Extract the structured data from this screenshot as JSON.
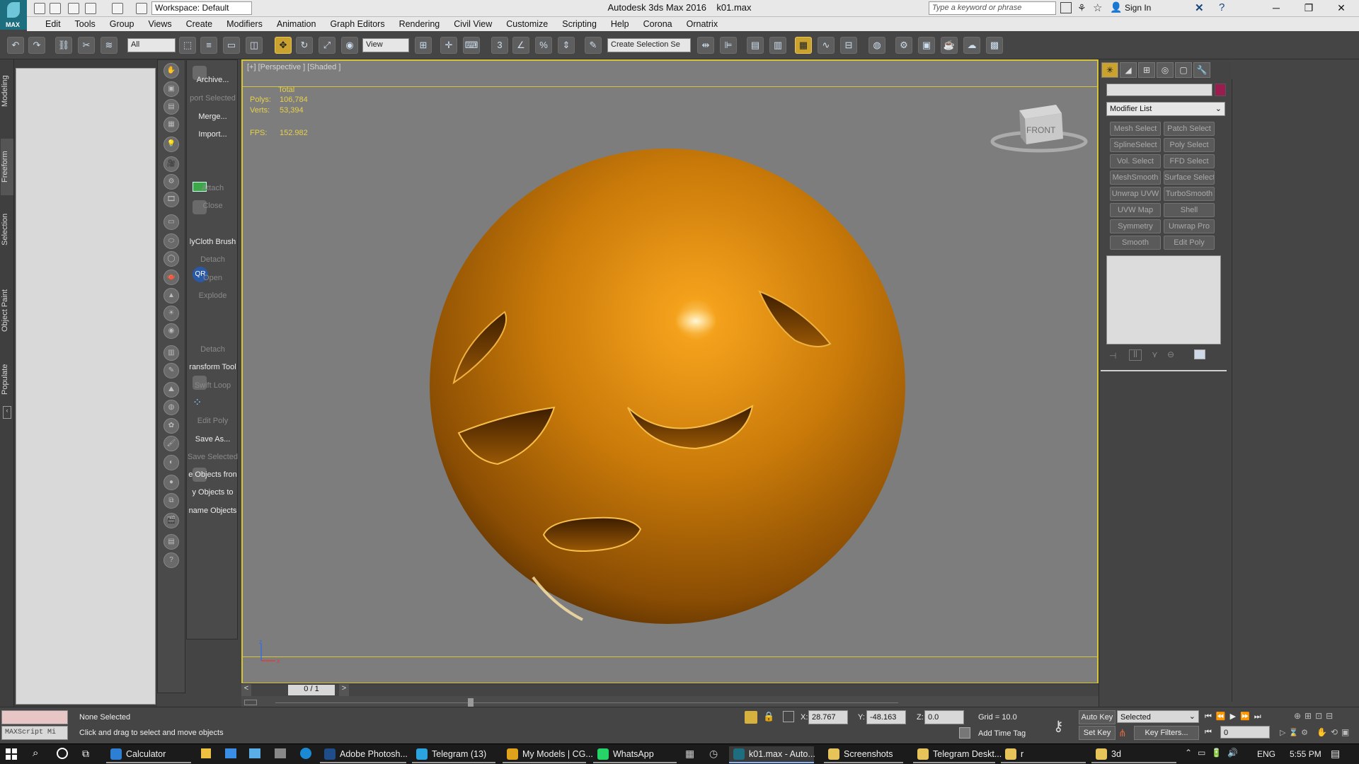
{
  "window": {
    "app_title": "Autodesk 3ds Max 2016",
    "file_name": "k01.max",
    "workspace": "Workspace: Default",
    "search_placeholder": "Type a keyword or phrase",
    "sign_in": "Sign In",
    "logo_label": "MAX"
  },
  "menu": {
    "items": [
      "Edit",
      "Tools",
      "Group",
      "Views",
      "Create",
      "Modifiers",
      "Animation",
      "Graph Editors",
      "Rendering",
      "Civil View",
      "Customize",
      "Scripting",
      "Help",
      "Corona",
      "Ornatrix"
    ]
  },
  "toolbar": {
    "selection_filter": "All",
    "ref_coord": "View",
    "named_selection": "Create Selection Se",
    "snap_label": "3"
  },
  "ribbon_tabs": [
    "Modeling",
    "Freeform",
    "Selection",
    "Object Paint",
    "Populate"
  ],
  "commands": [
    {
      "label": "Archive...",
      "dim": false
    },
    {
      "label": "port Selected",
      "dim": true
    },
    {
      "label": "Merge...",
      "dim": false
    },
    {
      "label": "Import...",
      "dim": false
    },
    {
      "label": "Attach",
      "dim": true
    },
    {
      "label": "Close",
      "dim": true
    },
    {
      "label": "lyCloth Brush",
      "dim": false
    },
    {
      "label": "Detach",
      "dim": true
    },
    {
      "label": "Open",
      "dim": true
    },
    {
      "label": "Explode",
      "dim": true
    },
    {
      "label": "Detach",
      "dim": true
    },
    {
      "label": "ransform Tool",
      "dim": false
    },
    {
      "label": "Swift Loop",
      "dim": true
    },
    {
      "label": "Edit Poly",
      "dim": true
    },
    {
      "label": "Save As...",
      "dim": false
    },
    {
      "label": "Save Selected",
      "dim": true
    },
    {
      "label": "e Objects fron",
      "dim": false
    },
    {
      "label": "y Objects to",
      "dim": false
    },
    {
      "label": "name Objects",
      "dim": false
    }
  ],
  "qr_label": "QR",
  "viewport": {
    "label": "[+] [Perspective ] [Shaded ]",
    "stats_header": "Total",
    "polys_label": "Polys:",
    "polys_value": "106,784",
    "verts_label": "Verts:",
    "verts_value": "53,394",
    "fps_label": "FPS:",
    "fps_value": "152.982",
    "viewcube_face": "FRONT",
    "axis_x": "x",
    "axis_z": "z"
  },
  "command_panel": {
    "modifier_list": "Modifier List",
    "modifiers": [
      "Mesh Select",
      "Patch Select",
      "SplineSelect",
      "Poly Select",
      "Vol. Select",
      "FFD Select",
      "MeshSmooth",
      "Surface Select",
      "Unwrap UVW",
      "TurboSmooth",
      "UVW Map",
      "Shell",
      "Symmetry",
      "Unwrap Pro",
      "Smooth",
      "Edit Poly"
    ]
  },
  "timeline": {
    "frame": "0 / 1",
    "prev": "<",
    "next": ">"
  },
  "status": {
    "maxscript": "MAXScript Mi",
    "selection": "None Selected",
    "prompt": "Click and drag to select and move objects",
    "x_label": "X:",
    "x_value": "28.767",
    "y_label": "Y:",
    "y_value": "-48.163",
    "z_label": "Z:",
    "z_value": "0.0",
    "grid": "Grid = 10.0",
    "add_time_tag": "Add Time Tag",
    "auto_key": "Auto Key",
    "set_key": "Set Key",
    "key_mode": "Selected",
    "key_filters": "Key Filters...",
    "frame_field": "0"
  },
  "taskbar": {
    "items": [
      {
        "label": "Calculator",
        "color": "#2d7fd3",
        "state": "open"
      },
      {
        "label": "Adobe Photosh...",
        "color": "#1f4d8a",
        "state": "open"
      },
      {
        "label": "Telegram (13)",
        "color": "#2aa3de",
        "state": "open"
      },
      {
        "label": "My Models | CG...",
        "color": "#e0a21b",
        "state": "open"
      },
      {
        "label": "WhatsApp",
        "color": "#25d366",
        "state": "open"
      },
      {
        "label": "k01.max - Auto...",
        "color": "#1d6e7f",
        "state": "active"
      },
      {
        "label": "Screenshots",
        "color": "#e6c45a",
        "state": "open"
      },
      {
        "label": "Telegram Deskt...",
        "color": "#e6c45a",
        "state": "open"
      },
      {
        "label": "r",
        "color": "#e6c45a",
        "state": "open"
      },
      {
        "label": "3d",
        "color": "#e6c45a",
        "state": "open"
      }
    ],
    "lang": "ENG",
    "time": "5:55 PM"
  },
  "colors": {
    "viewport_bg": "#7d7d7d",
    "active_border": "#d6c43a",
    "sphere_orange": "#c77a0a",
    "object_color": "#9b1c4f"
  }
}
